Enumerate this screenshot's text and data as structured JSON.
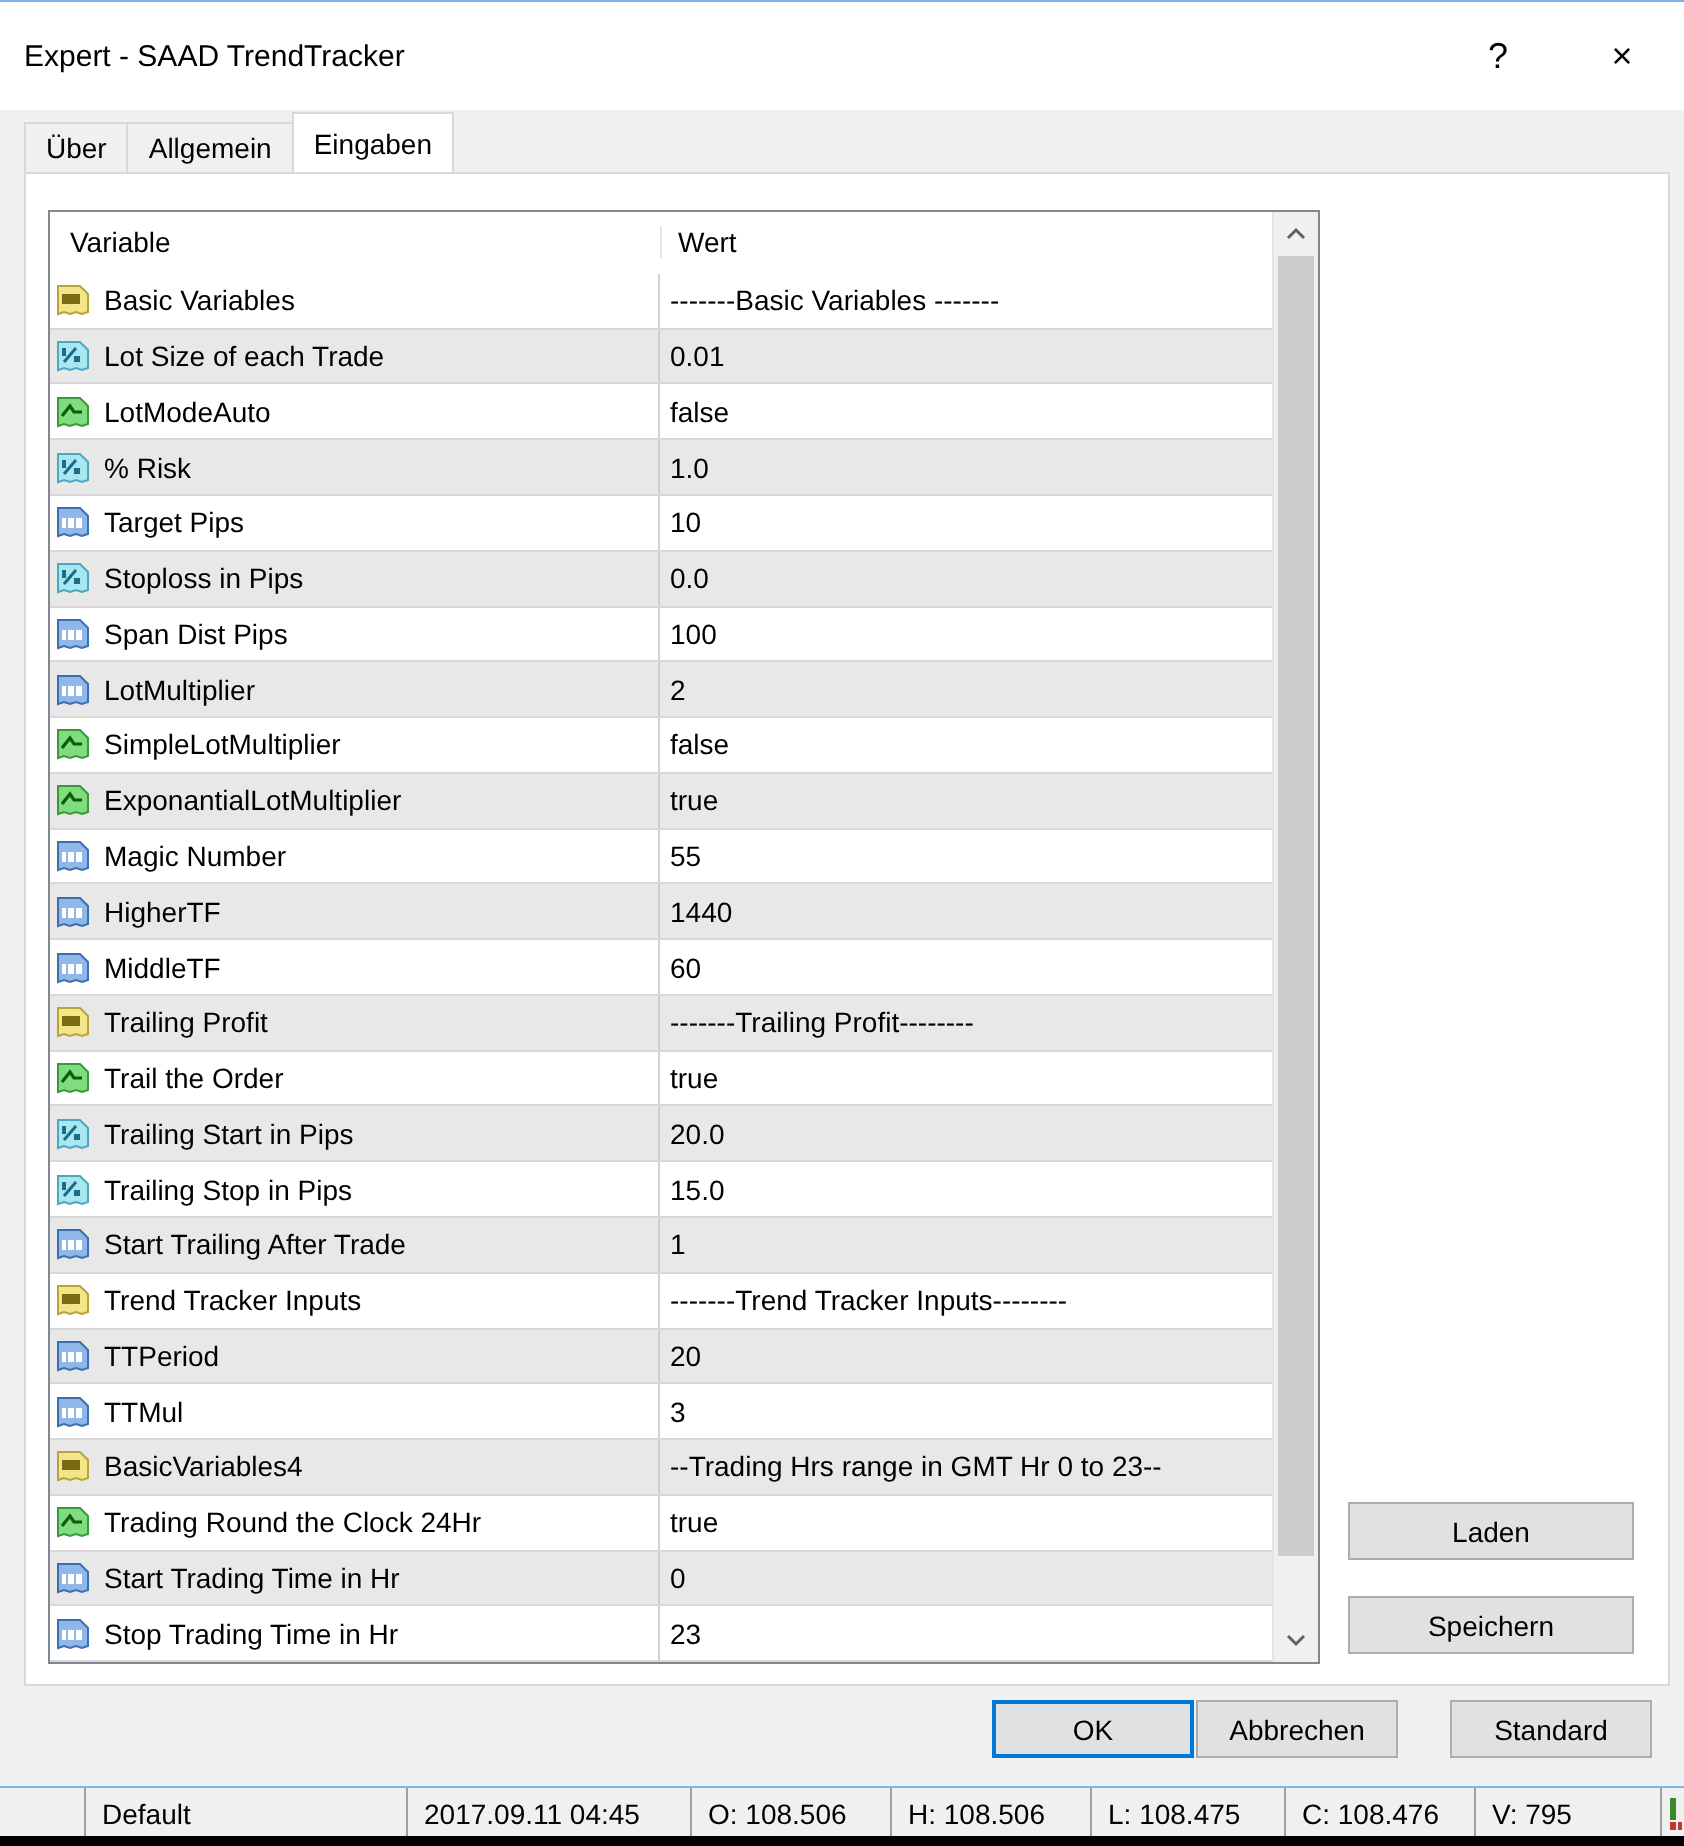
{
  "window": {
    "title": "Expert - SAAD TrendTracker",
    "help": "?",
    "close": "×"
  },
  "tabs": [
    {
      "label": "Über",
      "selected": false
    },
    {
      "label": "Allgemein",
      "selected": false
    },
    {
      "label": "Eingaben",
      "selected": true
    }
  ],
  "table": {
    "columns": [
      "Variable",
      "Wert"
    ],
    "rows": [
      {
        "kind": "string",
        "variable": "Basic Variables",
        "value": "-------Basic Variables -------"
      },
      {
        "kind": "double",
        "variable": "Lot Size of each Trade",
        "value": "0.01"
      },
      {
        "kind": "bool",
        "variable": "LotModeAuto",
        "value": "false"
      },
      {
        "kind": "double",
        "variable": "% Risk",
        "value": "1.0"
      },
      {
        "kind": "int",
        "variable": "Target Pips",
        "value": "10"
      },
      {
        "kind": "double",
        "variable": "Stoploss in Pips",
        "value": "0.0"
      },
      {
        "kind": "int",
        "variable": "Span Dist Pips",
        "value": "100"
      },
      {
        "kind": "int",
        "variable": "LotMultiplier",
        "value": "2"
      },
      {
        "kind": "bool",
        "variable": "SimpleLotMultiplier",
        "value": "false"
      },
      {
        "kind": "bool",
        "variable": "ExponantialLotMultiplier",
        "value": "true"
      },
      {
        "kind": "int",
        "variable": "Magic Number",
        "value": "55"
      },
      {
        "kind": "int",
        "variable": "HigherTF",
        "value": "1440"
      },
      {
        "kind": "int",
        "variable": "MiddleTF",
        "value": "60"
      },
      {
        "kind": "string",
        "variable": "Trailing Profit",
        "value": "-------Trailing Profit--------"
      },
      {
        "kind": "bool",
        "variable": "Trail the Order",
        "value": "true"
      },
      {
        "kind": "double",
        "variable": "Trailing Start in Pips",
        "value": "20.0"
      },
      {
        "kind": "double",
        "variable": "Trailing Stop in Pips",
        "value": "15.0"
      },
      {
        "kind": "int",
        "variable": "Start Trailing After Trade",
        "value": "1"
      },
      {
        "kind": "string",
        "variable": "Trend Tracker Inputs",
        "value": "-------Trend Tracker Inputs--------"
      },
      {
        "kind": "int",
        "variable": "TTPeriod",
        "value": "20"
      },
      {
        "kind": "int",
        "variable": "TTMul",
        "value": "3"
      },
      {
        "kind": "string",
        "variable": "BasicVariables4",
        "value": "--Trading Hrs range in GMT Hr 0 to 23--"
      },
      {
        "kind": "bool",
        "variable": "Trading Round the Clock 24Hr",
        "value": "true"
      },
      {
        "kind": "int",
        "variable": "Start Trading Time in Hr",
        "value": "0"
      },
      {
        "kind": "int",
        "variable": "Stop Trading Time in Hr",
        "value": "23"
      }
    ]
  },
  "side_buttons": [
    "Laden",
    "Speichern"
  ],
  "dialog_buttons": [
    {
      "label": "OK",
      "default": true
    },
    {
      "label": "Abbrechen",
      "default": false
    },
    {
      "label": "Standard",
      "default": false
    }
  ],
  "status_bar": [
    "Default",
    "2017.09.11 04:45",
    "O: 108.506",
    "H: 108.506",
    "L: 108.475",
    "C: 108.476",
    "V: 795"
  ]
}
